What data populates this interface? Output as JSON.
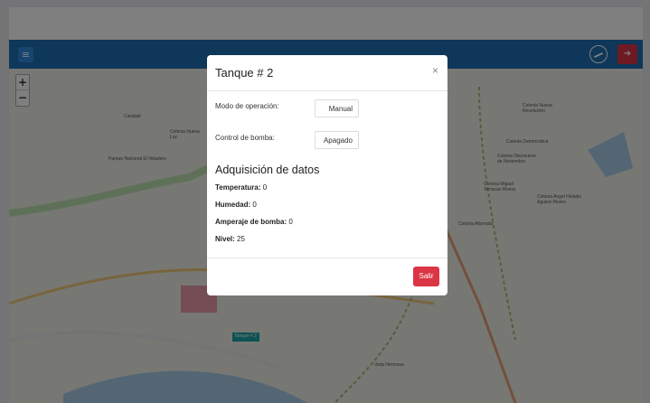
{
  "navbar": {
    "menu_icon": "hamburger-icon",
    "compass_icon": "compass-icon",
    "logout_icon": "logout-icon",
    "accent": "#1d6fb3",
    "logout_color": "#dc3545"
  },
  "map": {
    "zoom_in": "+",
    "zoom_out": "−",
    "labels": [
      "Carabali",
      "Colonia Nueva Luz",
      "Parque Nacional El Veladero",
      "Colonia Nueva Revolución",
      "Colonia Democrática",
      "Colonia Diecinueve de Noviembre",
      "Colonia Miguel Terrazas Rivera",
      "Colonia Angel Heladio Aguirre Rivero",
      "Colonia Alborada",
      "Vista Hermosa",
      "Tanque # 2"
    ]
  },
  "modal": {
    "title": "Tanque # 2",
    "close": "×",
    "mode_label": "Modo de operación:",
    "mode_value": "Manual",
    "pump_label": "Control de bomba:",
    "pump_value": "Apagado",
    "section_title": "Adquisición de datos",
    "temperature_label": "Temperatura:",
    "temperature_value": "0",
    "humidity_label": "Humedad:",
    "humidity_value": "0",
    "amperage_label": "Amperaje de bomba:",
    "amperage_value": "0",
    "level_label": "Nivel:",
    "level_value": "25",
    "exit_button": "Salir"
  }
}
